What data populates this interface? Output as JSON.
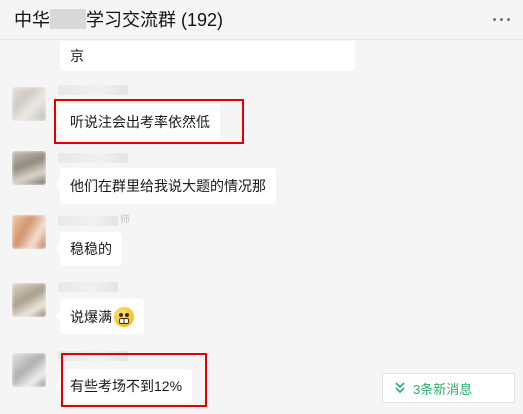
{
  "header": {
    "title_prefix": "中华",
    "title_suffix": "学习交流群 (192)",
    "more_icon": "more-dots-icon"
  },
  "messages": [
    {
      "text": "京",
      "highlighted": false
    },
    {
      "text": "听说注会出考率依然低",
      "highlighted": true
    },
    {
      "text": "他们在群里给我说大题的情况那",
      "highlighted": false
    },
    {
      "text": "稳稳的",
      "highlighted": false,
      "name_tail": "师"
    },
    {
      "text": "说爆满",
      "highlighted": false,
      "emoji": "grimacing-face-icon"
    },
    {
      "text": "有些考场不到12%",
      "highlighted": true
    }
  ],
  "new_messages": {
    "label": "3条新消息",
    "icon": "double-chevron-down-icon",
    "color": "#2aae67"
  },
  "colors": {
    "background": "#f5f5f5",
    "bubble": "#ffffff",
    "highlight": "#e00000"
  }
}
